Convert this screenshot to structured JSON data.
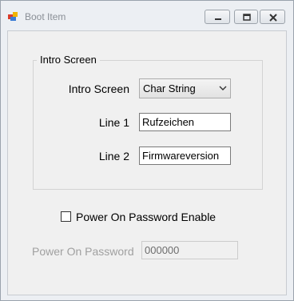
{
  "window": {
    "title": "Boot Item",
    "icon": "app-icon"
  },
  "controls": {
    "minimize_icon": "minimize-icon",
    "maximize_icon": "maximize-icon",
    "close_icon": "close-icon"
  },
  "intro_group": {
    "title": "Intro Screen",
    "intro_screen_label": "Intro Screen",
    "intro_screen_value": "Char String",
    "line1_label": "Line 1",
    "line1_value": "Rufzeichen",
    "line2_label": "Line 2",
    "line2_value": "Firmwareversion"
  },
  "password": {
    "enable_label": "Power On Password Enable",
    "enable_checked": false,
    "password_label": "Power On Password",
    "password_value": "000000",
    "password_enabled": false
  }
}
